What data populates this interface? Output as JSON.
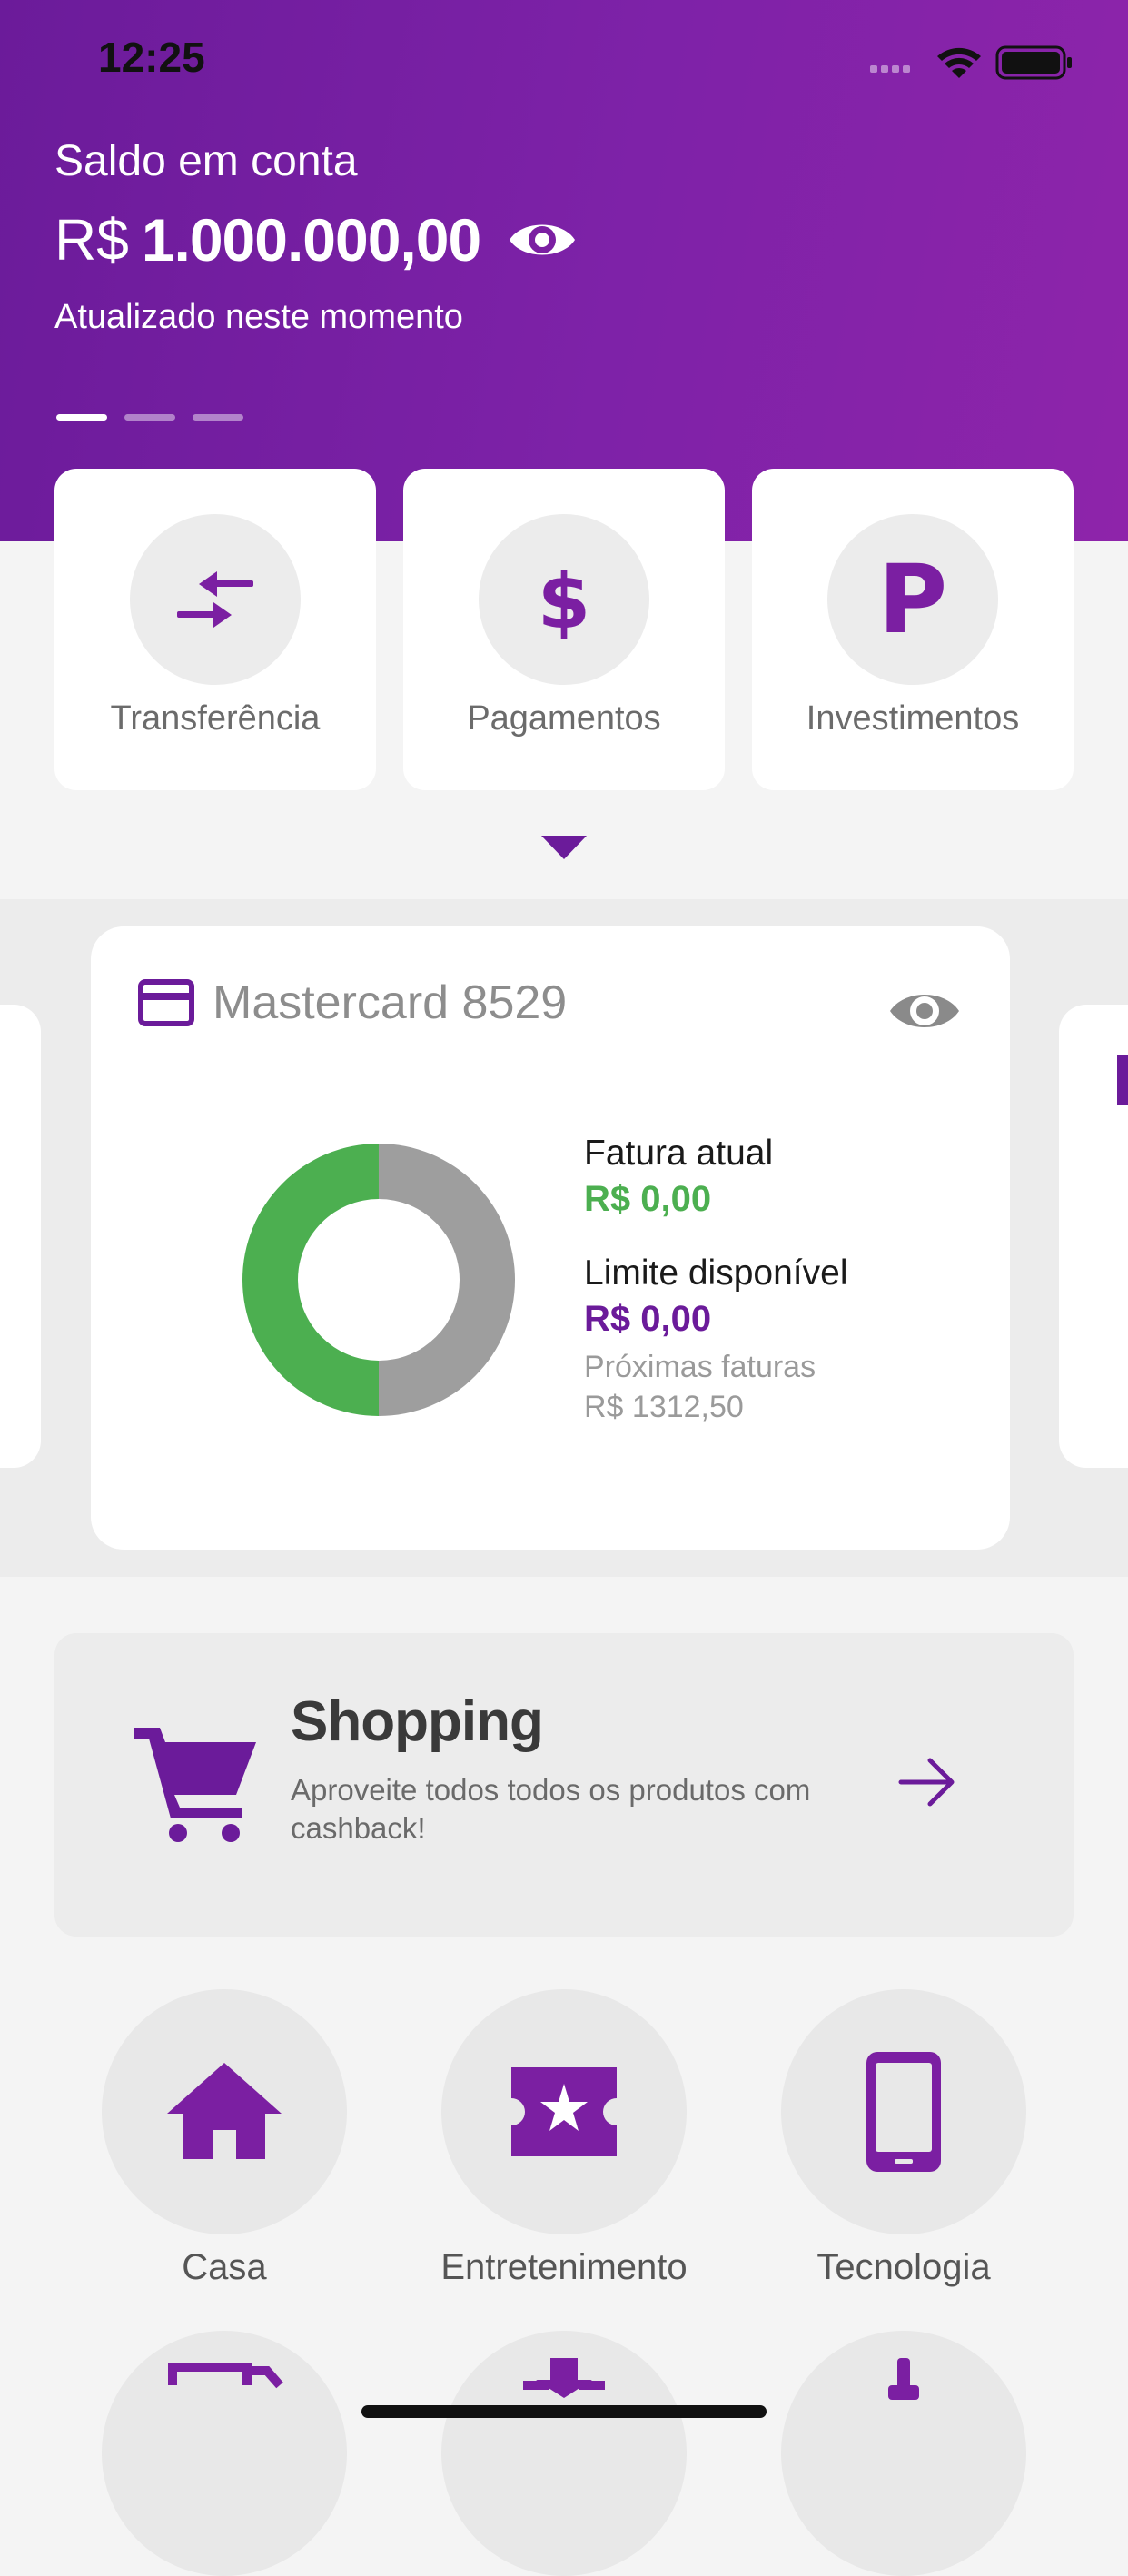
{
  "status_bar": {
    "time": "12:25"
  },
  "balance": {
    "label": "Saldo em conta",
    "currency": "R$",
    "amount": "1.000.000,00",
    "updated": "Atualizado neste momento",
    "pager": {
      "pages": 3,
      "active": 0
    }
  },
  "actions": [
    {
      "label": "Transferência",
      "icon": "transfer-arrows-icon"
    },
    {
      "label": "Pagamentos",
      "icon": "dollar-icon"
    },
    {
      "label": "Investimentos",
      "icon": "p-letter-icon"
    }
  ],
  "credit_card": {
    "name": "Mastercard 8529",
    "bill_label": "Fatura atual",
    "bill_value": "R$ 0,00",
    "limit_label": "Limite disponível",
    "limit_value": "R$ 0,00",
    "next_label": "Próximas faturas",
    "next_value": "R$ 1312,50",
    "chart": {
      "used_fraction": 0.5,
      "colors": {
        "used": "#4caf50",
        "available": "#9e9e9e"
      }
    }
  },
  "shopping": {
    "title": "Shopping",
    "description": "Aproveite todos todos os produtos com cashback!"
  },
  "categories": [
    {
      "label": "Casa",
      "icon": "house-icon"
    },
    {
      "label": "Entretenimento",
      "icon": "ticket-star-icon"
    },
    {
      "label": "Tecnologia",
      "icon": "smartphone-icon"
    }
  ],
  "colors": {
    "brand": "#7b1fa2",
    "positive": "#4caf50"
  }
}
